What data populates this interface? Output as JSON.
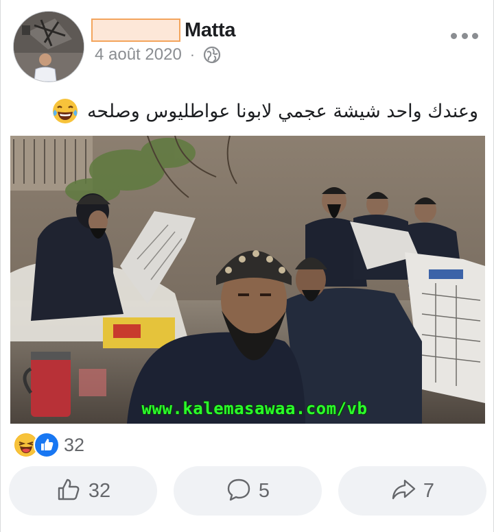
{
  "post": {
    "author_name": "Matta",
    "date": "4 août 2020",
    "meta_separator": "·",
    "privacy_icon": "globe-icon",
    "menu_icon": "more-options-icon",
    "caption": "وعندك واحد شيشة عجمي لابونا عواطليوس وصلحه",
    "caption_emoji": "laughing-tears-emoji"
  },
  "image": {
    "watermark": "www.kalemasawaa.com/vb"
  },
  "reactions": {
    "icons": [
      "haha-reaction-icon",
      "like-reaction-icon"
    ],
    "count": "32"
  },
  "actions": {
    "like_count": "32",
    "comment_count": "5",
    "share_count": "7"
  },
  "colors": {
    "accent_blue": "#1877f2",
    "haha_yellow": "#f7b928",
    "button_bg": "#f0f2f5",
    "muted_text": "#65676b",
    "redaction_fill": "#fde7d8",
    "redaction_border": "#f3a45c",
    "watermark_green": "#2bff2b"
  }
}
